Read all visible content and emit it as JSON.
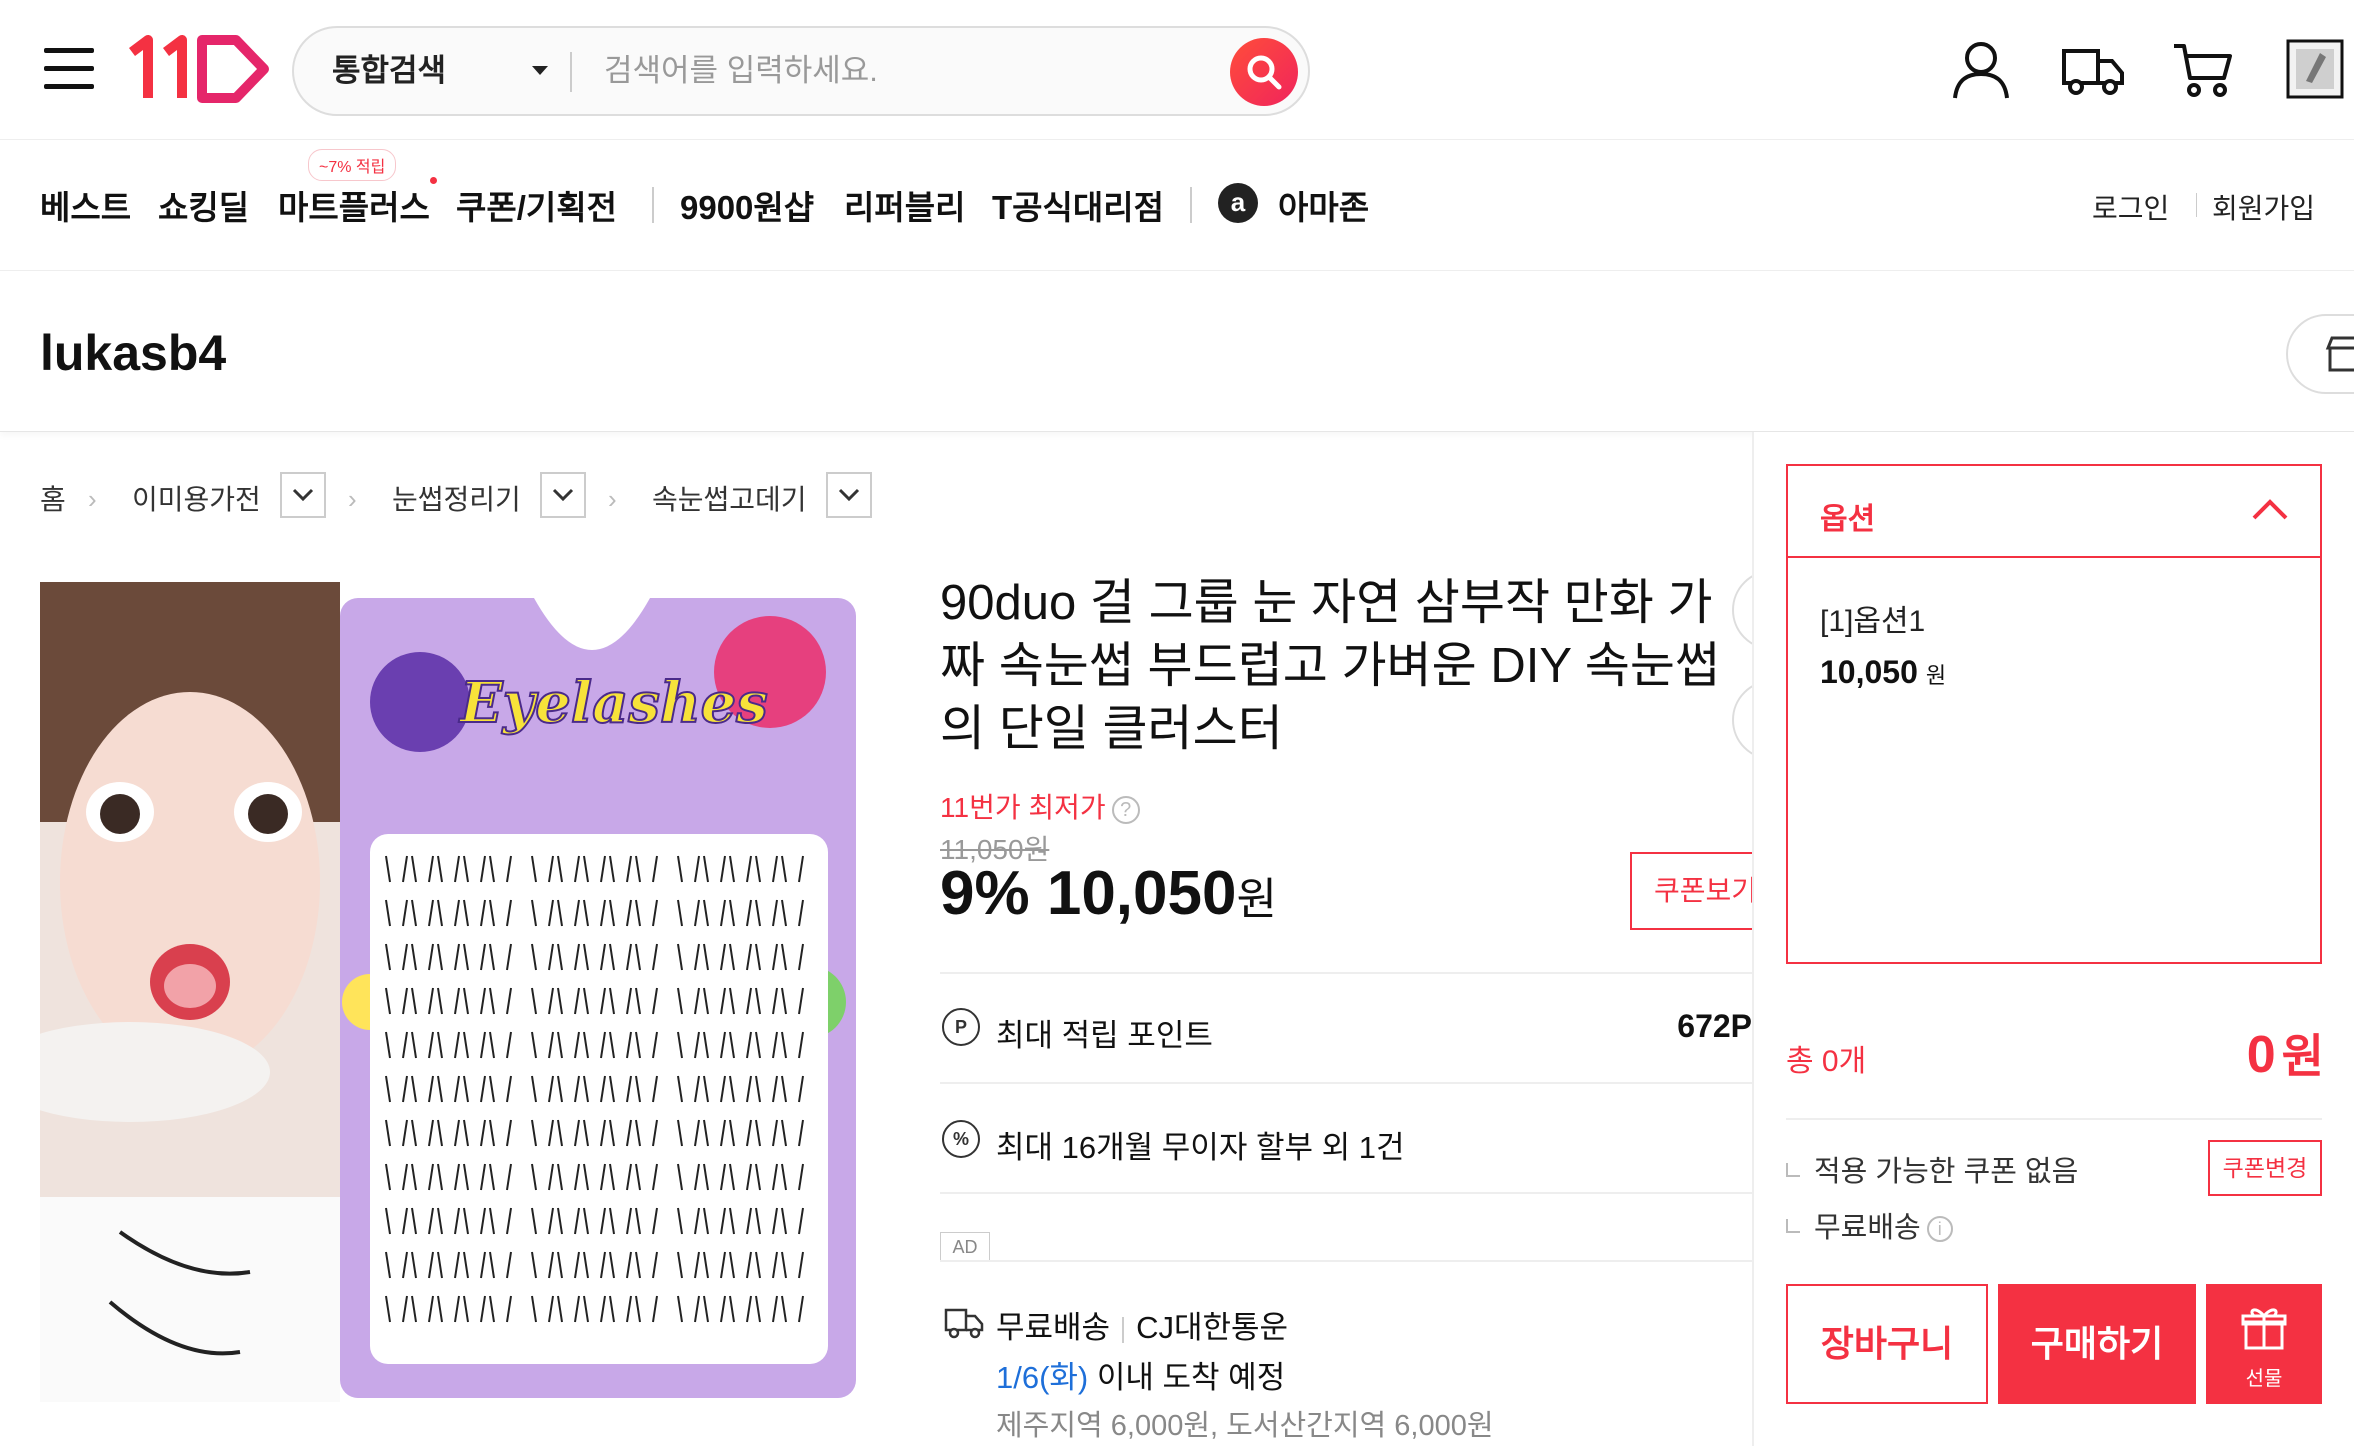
{
  "header": {
    "logo_text": "11번가",
    "search_scope": "통합검색",
    "search_placeholder": "검색어를 입력하세요.",
    "icons": [
      "hamburger-menu-icon",
      "my-account-icon",
      "delivery-truck-icon",
      "cart-icon",
      "recent-viewed-icon"
    ]
  },
  "nav": {
    "items": [
      "베스트",
      "쇼킹딜",
      "마트플러스",
      "쿠폰/기획전",
      "9900원샵",
      "리퍼블리",
      "T공식대리점",
      "아마존"
    ],
    "badge": "~7% 적립",
    "amazon_letter": "a",
    "login": "로그인",
    "signup": "회원가입"
  },
  "seller": {
    "name": "lukasb4"
  },
  "breadcrumb": [
    "홈",
    "이미용가전",
    "눈썹정리기",
    "속눈썹고데기"
  ],
  "product": {
    "image_text": "Eyelashes",
    "title": "90duo 걸 그룹 눈 자연 삼부작 만화 가짜 속눈썹 부드럽고 가벼운 DIY 속눈썹의 단일 클러스터",
    "lowest_label": "11번가 최저가",
    "original_price": "11,050원",
    "discount": "9%",
    "sale_price": "10,050",
    "won": "원",
    "coupon_button": "쿠폰보기",
    "points_icon": "P",
    "points_label": "최대 적립 포인트",
    "points_value": "672P",
    "installment_icon": "%",
    "installment_label": "최대 16개월 무이자 할부 외 1건",
    "ad_badge": "AD",
    "shipping_free": "무료배송",
    "courier": "CJ대한통운",
    "eta_date": "1/6(화)",
    "eta_text": " 이내 도착 예정",
    "region_fee": "제주지역 6,000원, 도서산간지역 6,000원"
  },
  "options": {
    "title": "옵션",
    "item_name": "[1]옵션1",
    "item_price": "10,050",
    "item_won": "원",
    "total_label": "총 0개",
    "total_value": "0",
    "total_won": "원",
    "coupon_none": "적용 가능한 쿠폰 없음",
    "coupon_change": "쿠폰변경",
    "free_shipping": "무료배송",
    "info_mark": "i",
    "cart_button": "장바구니",
    "buy_button": "구매하기",
    "gift_button": "선물"
  },
  "colors": {
    "brand_red": "#f43142",
    "link_blue": "#1e6fd9"
  }
}
